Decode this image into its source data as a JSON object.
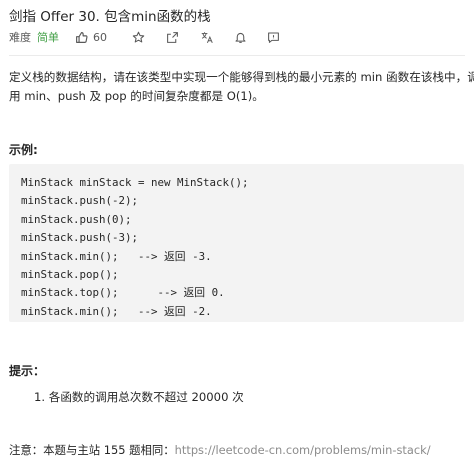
{
  "problem": {
    "title": "剑指 Offer 30. 包含min函数的栈",
    "difficulty_label": "难度",
    "difficulty": "简单",
    "likes": "60"
  },
  "description": {
    "line1": "定义栈的数据结构，请在该类型中实现一个能够得到栈的最小元素的 min 函数在该栈中，调",
    "line2": "用 min、push 及 pop 的时间复杂度都是 O(1)。"
  },
  "example": {
    "heading": "示例:",
    "code_lines": [
      "MinStack minStack = new MinStack();",
      "minStack.push(-2);",
      "minStack.push(0);",
      "minStack.push(-3);",
      "minStack.min();   --> 返回 -3.",
      "minStack.pop();",
      "minStack.top();      --> 返回 0.",
      "minStack.min();   --> 返回 -2."
    ]
  },
  "tips": {
    "heading": "提示：",
    "items": [
      "1. 各函数的调用总次数不超过 20000 次"
    ]
  },
  "note": {
    "label": "注意：本题与主站 155 题相同：",
    "link": "https://leetcode-cn.com/problems/min-stack/"
  },
  "colors": {
    "easy": "#43a047",
    "code_bg": "#f3f3f3",
    "link": "#8c8c8c"
  }
}
